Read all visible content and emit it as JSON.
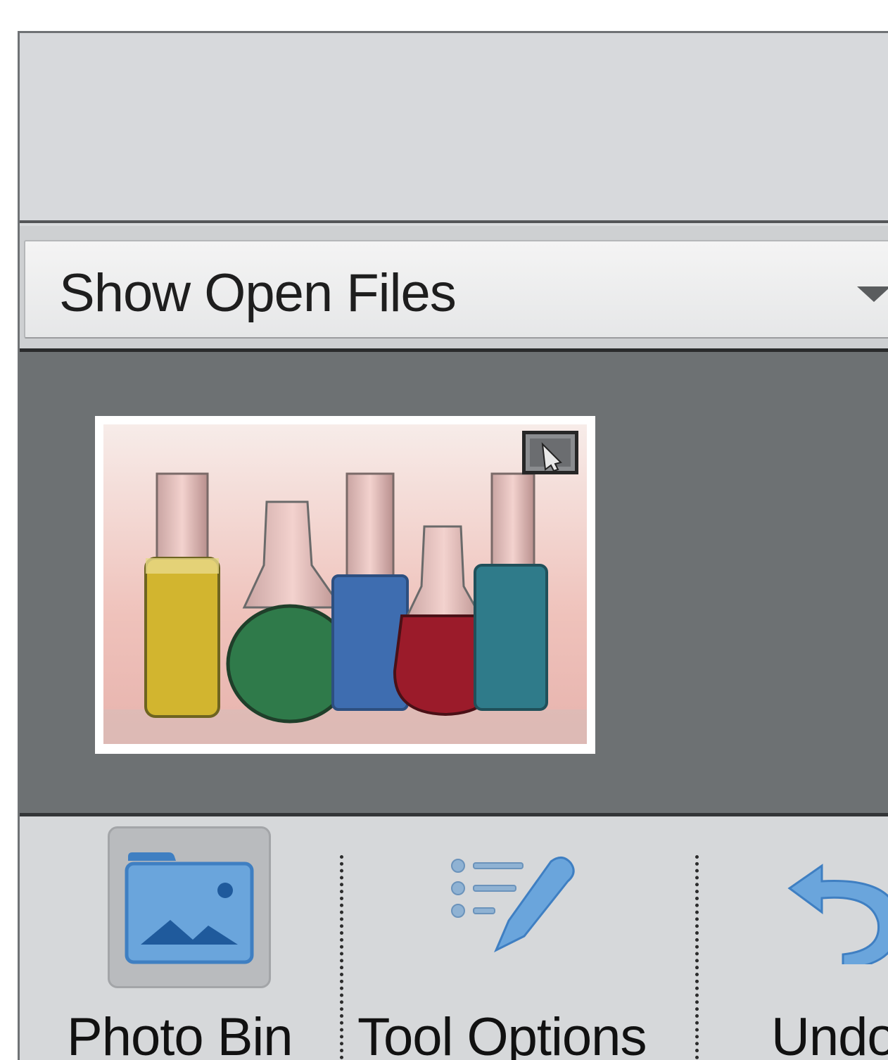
{
  "dropdown": {
    "label": "Show Open Files",
    "icon": "chevron-down-icon"
  },
  "photo_bin": {
    "thumbnails": [
      {
        "description_icon": "image-thumbnail",
        "badge_icon": "edit-badge-icon"
      }
    ]
  },
  "taskbar": {
    "buttons": [
      {
        "label": "Photo Bin",
        "icon": "photo-folder-icon",
        "active": true
      },
      {
        "label": "Tool Options",
        "icon": "tool-options-icon",
        "active": false
      },
      {
        "label": "Undo",
        "icon": "undo-icon",
        "active": false
      }
    ]
  },
  "colors": {
    "bin_background": "#6d7173",
    "panel_background": "#d9dbdd",
    "icon_blue": "#6aa5dc"
  }
}
